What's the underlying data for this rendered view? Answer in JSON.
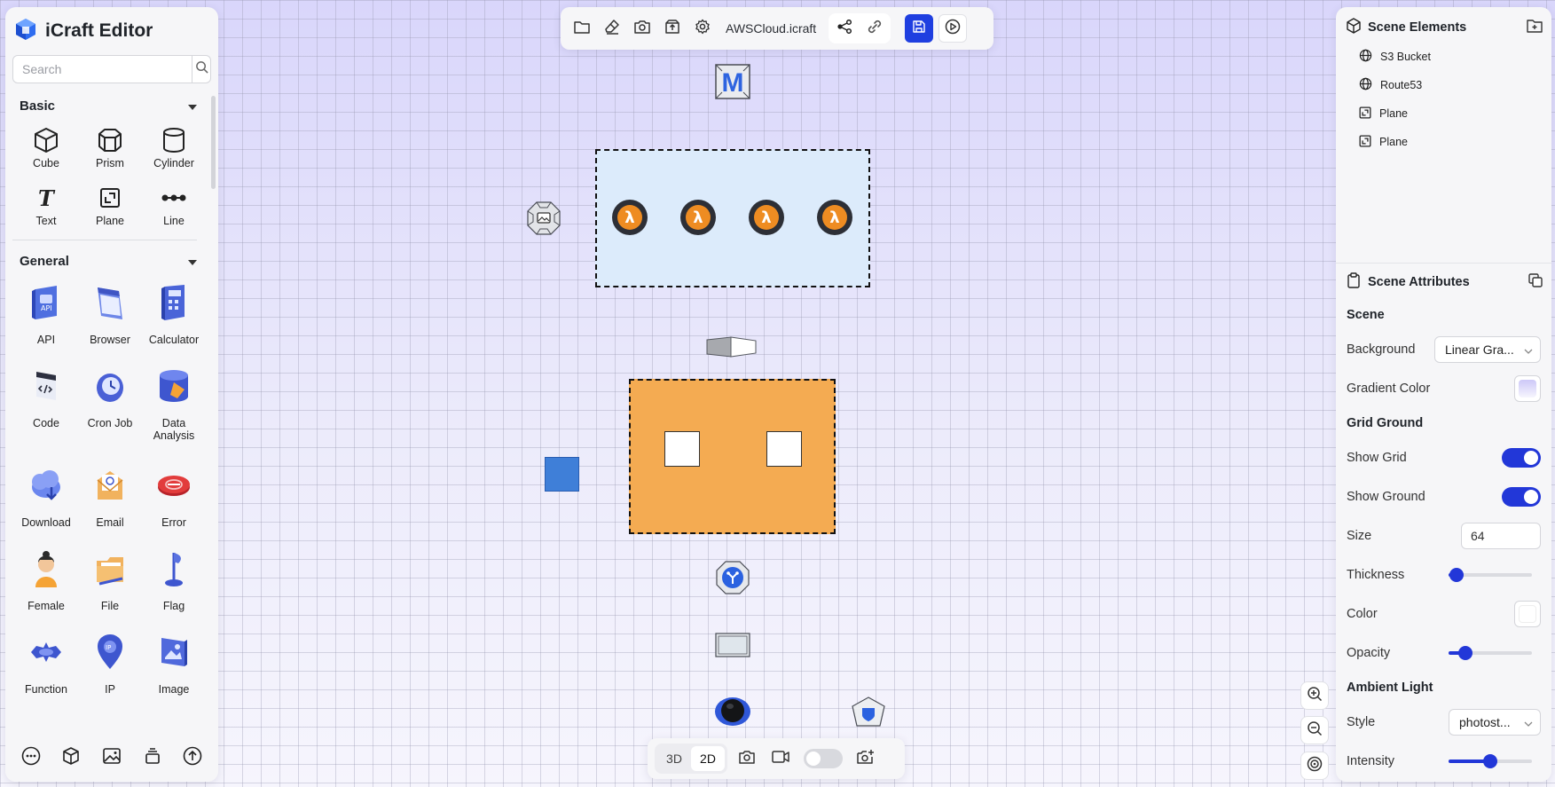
{
  "app": {
    "title": "iCraft Editor",
    "search_placeholder": "Search"
  },
  "library": {
    "basic": {
      "title": "Basic",
      "items": [
        {
          "label": "Cube",
          "icon": "cube-icon"
        },
        {
          "label": "Prism",
          "icon": "prism-icon"
        },
        {
          "label": "Cylinder",
          "icon": "cylinder-icon"
        },
        {
          "label": "Text",
          "icon": "text-icon"
        },
        {
          "label": "Plane",
          "icon": "plane-icon"
        },
        {
          "label": "Line",
          "icon": "line-icon"
        }
      ]
    },
    "general": {
      "title": "General",
      "items": [
        {
          "label": "API",
          "icon": "api-icon"
        },
        {
          "label": "Browser",
          "icon": "browser-icon"
        },
        {
          "label": "Calculator",
          "icon": "calculator-icon"
        },
        {
          "label": "Code",
          "icon": "code-icon"
        },
        {
          "label": "Cron Job",
          "icon": "cron-job-icon"
        },
        {
          "label": "Data Analysis",
          "icon": "data-analysis-icon"
        },
        {
          "label": "Download",
          "icon": "download-icon"
        },
        {
          "label": "Email",
          "icon": "email-icon"
        },
        {
          "label": "Error",
          "icon": "error-icon"
        },
        {
          "label": "Female",
          "icon": "female-icon"
        },
        {
          "label": "File",
          "icon": "file-icon"
        },
        {
          "label": "Flag",
          "icon": "flag-icon"
        },
        {
          "label": "Function",
          "icon": "function-icon"
        },
        {
          "label": "IP",
          "icon": "ip-icon"
        },
        {
          "label": "Image",
          "icon": "image-icon"
        }
      ]
    }
  },
  "toolbar": {
    "filename": "AWSCloud.icraft"
  },
  "bottom_toolbar": {
    "mode_3d": "3D",
    "mode_2d": "2D",
    "active_mode": "2D",
    "toggle_on": false
  },
  "scene_elements": {
    "title": "Scene Elements",
    "items": [
      {
        "label": "S3 Bucket",
        "icon": "globe-icon"
      },
      {
        "label": "Route53",
        "icon": "globe-icon"
      },
      {
        "label": "Plane",
        "icon": "plane-icon"
      },
      {
        "label": "Plane",
        "icon": "plane-icon"
      }
    ]
  },
  "scene_attributes": {
    "title": "Scene Attributes",
    "scene": {
      "title": "Scene",
      "background_label": "Background",
      "background_value": "Linear Gra...",
      "gradient_color_label": "Gradient Color"
    },
    "grid_ground": {
      "title": "Grid Ground",
      "show_grid_label": "Show Grid",
      "show_grid": true,
      "show_ground_label": "Show Ground",
      "show_ground": true,
      "size_label": "Size",
      "size_value": "64",
      "thickness_label": "Thickness",
      "thickness": 0.1,
      "color_label": "Color",
      "color": "#ffffff",
      "opacity_label": "Opacity",
      "opacity": 0.2
    },
    "ambient_light": {
      "title": "Ambient Light",
      "style_label": "Style",
      "style_value": "photost...",
      "intensity_label": "Intensity",
      "intensity": 0.5
    }
  },
  "colors": {
    "accent": "#1f3fe0",
    "lambda_orange": "#ee8c22",
    "group_orange": "#f4ab52",
    "group_blue": "#dcebfb",
    "blue_square": "#3f7fd8"
  }
}
